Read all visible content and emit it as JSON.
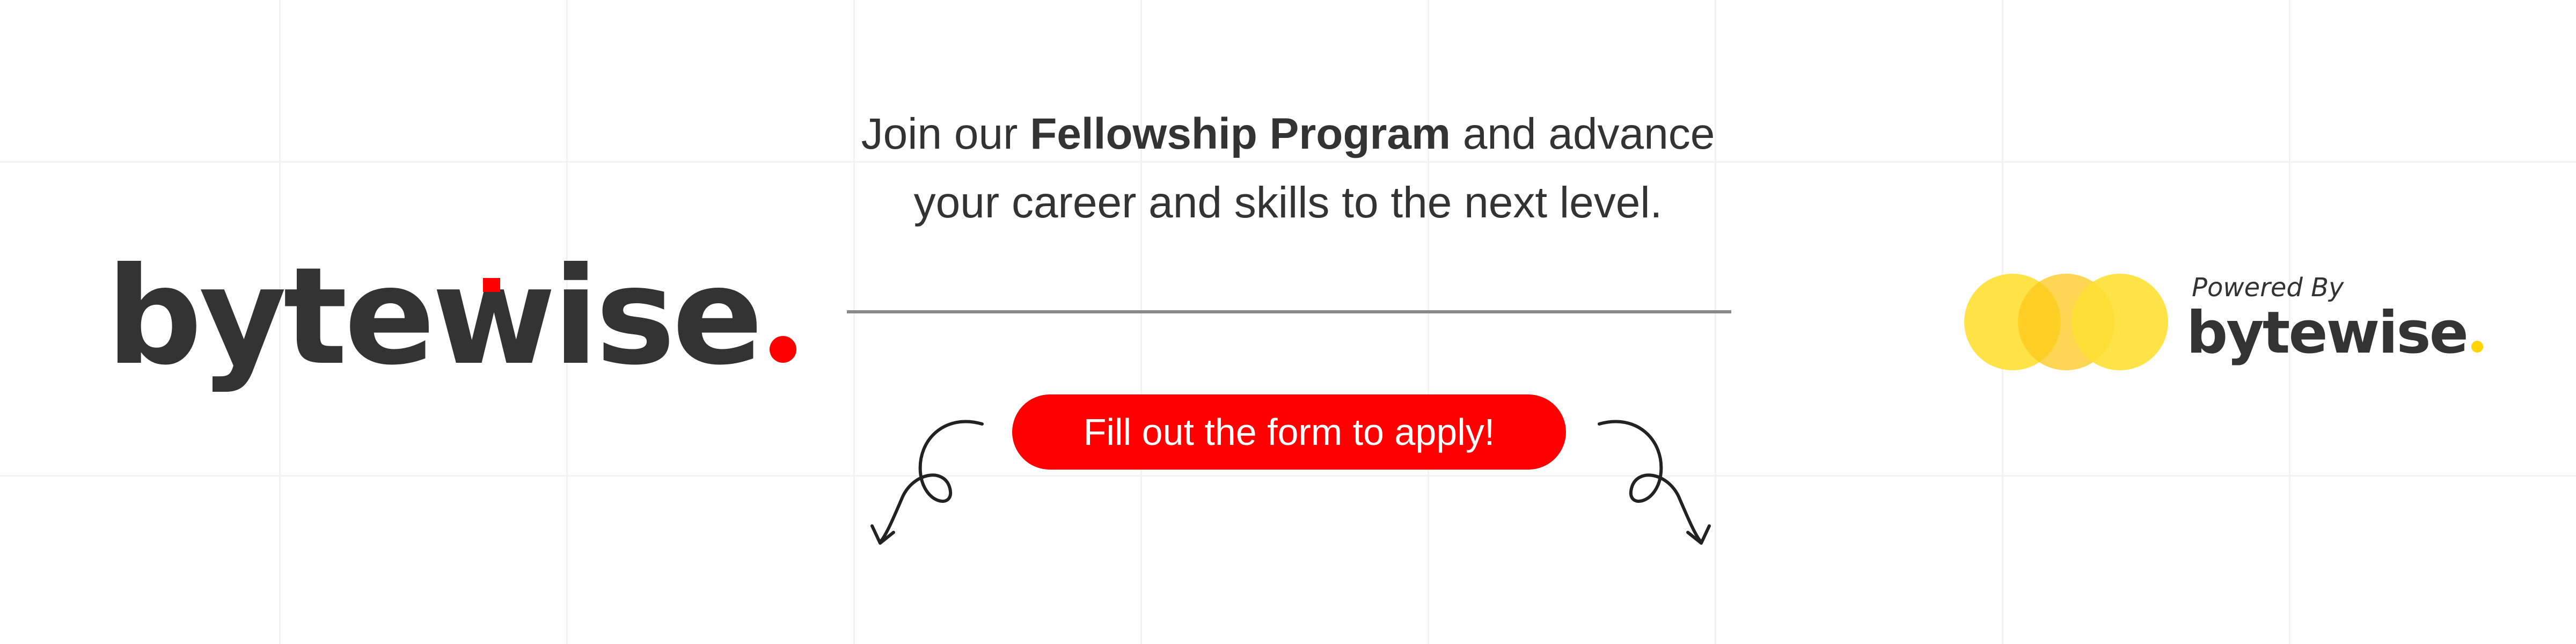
{
  "brand": {
    "wordmark": "bytewise",
    "dot_color": "#ff0000"
  },
  "headline": {
    "pre": "Join our",
    "emphasis": "Fellowship Program",
    "post": "and advance",
    "line2": "your career and skills to the next level."
  },
  "cta": {
    "label": "Fill out the form to apply!",
    "color": "#ff0000"
  },
  "powered": {
    "label": "Powered By",
    "wordmark": "bytewise",
    "dot_color": "#ffd400",
    "circle_colors": [
      "#ffe033",
      "#ffc81a"
    ]
  },
  "icons": {
    "left": "curly-arrow-down-left-icon",
    "right": "curly-arrow-down-right-icon",
    "logo": "overlapping-circles-icon"
  }
}
